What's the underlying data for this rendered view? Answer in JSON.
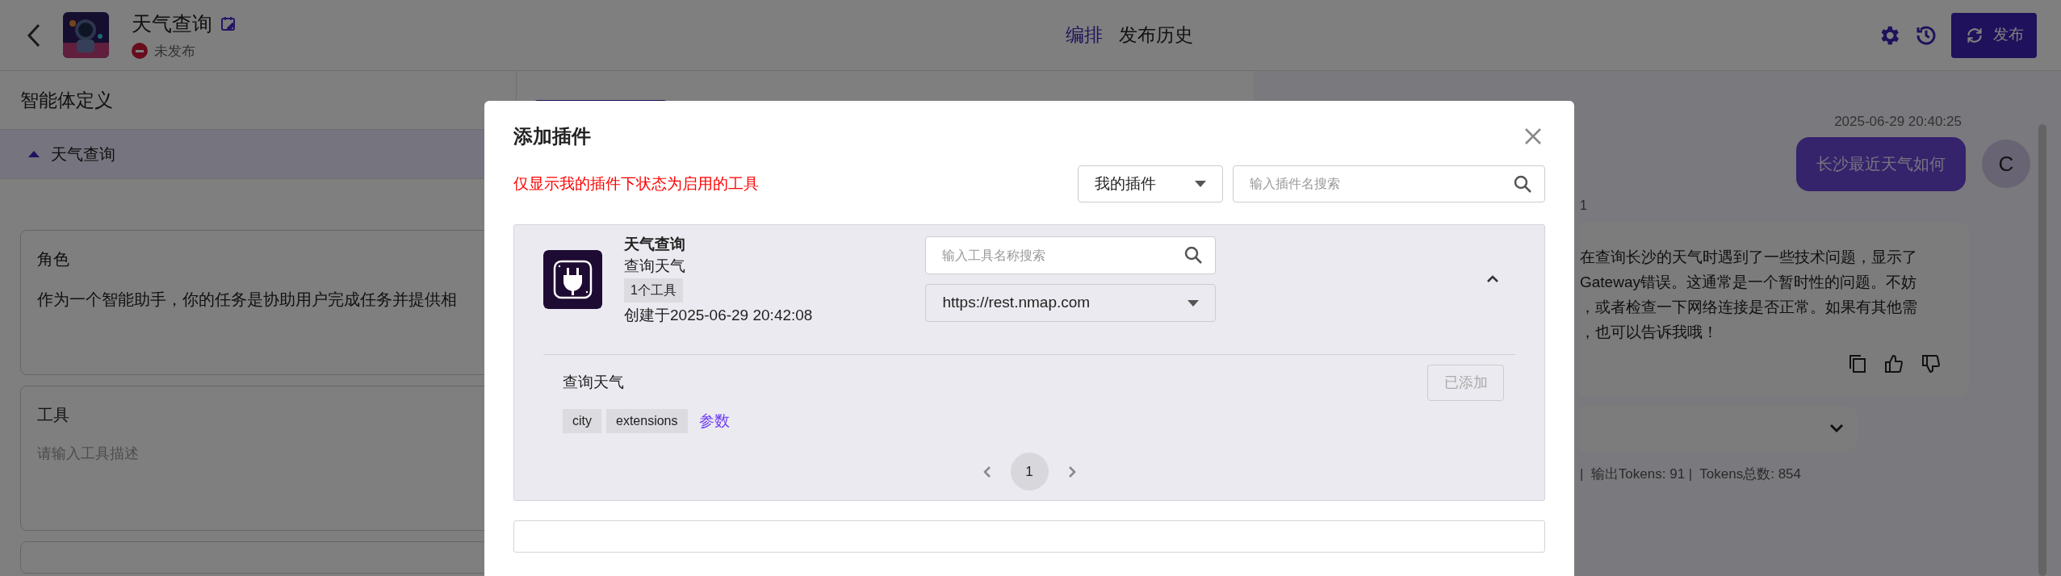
{
  "header": {
    "title": "天气查询",
    "status": "未发布",
    "published": false,
    "tabs": [
      {
        "label": "编排",
        "selected": true
      },
      {
        "label": "发布历史",
        "selected": false
      }
    ],
    "publish_button": "发布"
  },
  "left_panel": {
    "title": "智能体定义",
    "section": {
      "label": "天气查询",
      "expanded": true
    },
    "cards": [
      {
        "title": "角色",
        "value": "作为一个智能助手，你的任务是协助用户完成任务并提供相"
      },
      {
        "title": "工具",
        "placeholder": "请输入工具描述"
      }
    ]
  },
  "preview": {
    "time": "2025-06-29 20:40:25",
    "user_message": "长沙最近天气如何",
    "user_avatar": "C",
    "reply_meta": "1",
    "reply_lines": [
      "在查询长沙的天气时遇到了一些技术问题，显示了",
      "Gateway错误。这通常是一个暂时性的问题。不妨",
      "，或者检查一下网络连接是否正常。如果有其他需",
      "，也可以告诉我哦！"
    ],
    "tokens": "|  输出Tokens: 91 |  Tokens总数: 854"
  },
  "modal": {
    "title": "添加插件",
    "notice": "仅显示我的插件下状态为启用的工具",
    "filter": "我的插件",
    "search_placeholder": "输入插件名搜索",
    "plugins": [
      {
        "name": "天气查询",
        "description": "查询天气",
        "tool_count": "1个工具",
        "created": "创建于2025-06-29 20:42:08",
        "tool_search_placeholder": "输入工具名称搜索",
        "server": "https://rest.nmap.com",
        "expanded": true,
        "tools": [
          {
            "name": "查询天气",
            "params": [
              "city",
              "extensions"
            ],
            "params_link": "参数",
            "action": "已添加",
            "added": true
          }
        ]
      }
    ],
    "pages": [
      {
        "label": "1",
        "selected": true
      }
    ]
  }
}
